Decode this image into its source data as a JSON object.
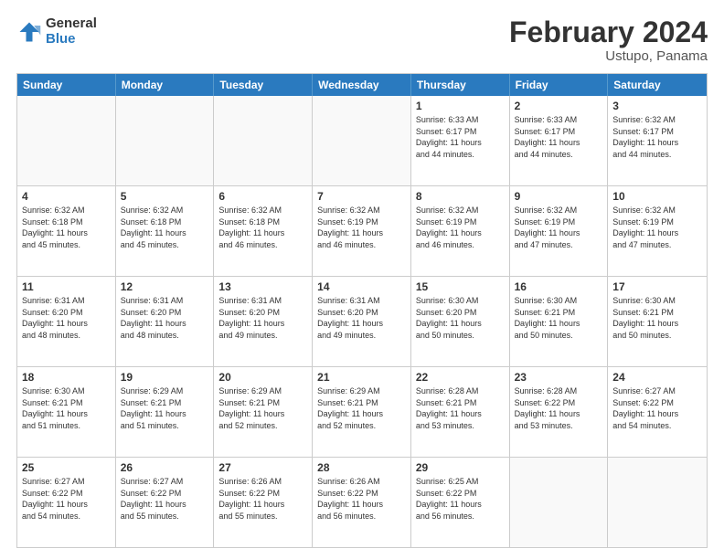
{
  "logo": {
    "general": "General",
    "blue": "Blue"
  },
  "title": "February 2024",
  "subtitle": "Ustupo, Panama",
  "header_days": [
    "Sunday",
    "Monday",
    "Tuesday",
    "Wednesday",
    "Thursday",
    "Friday",
    "Saturday"
  ],
  "rows": [
    [
      {
        "day": "",
        "info": "",
        "empty": true
      },
      {
        "day": "",
        "info": "",
        "empty": true
      },
      {
        "day": "",
        "info": "",
        "empty": true
      },
      {
        "day": "",
        "info": "",
        "empty": true
      },
      {
        "day": "1",
        "info": "Sunrise: 6:33 AM\nSunset: 6:17 PM\nDaylight: 11 hours\nand 44 minutes.",
        "empty": false
      },
      {
        "day": "2",
        "info": "Sunrise: 6:33 AM\nSunset: 6:17 PM\nDaylight: 11 hours\nand 44 minutes.",
        "empty": false
      },
      {
        "day": "3",
        "info": "Sunrise: 6:32 AM\nSunset: 6:17 PM\nDaylight: 11 hours\nand 44 minutes.",
        "empty": false
      }
    ],
    [
      {
        "day": "4",
        "info": "Sunrise: 6:32 AM\nSunset: 6:18 PM\nDaylight: 11 hours\nand 45 minutes.",
        "empty": false
      },
      {
        "day": "5",
        "info": "Sunrise: 6:32 AM\nSunset: 6:18 PM\nDaylight: 11 hours\nand 45 minutes.",
        "empty": false
      },
      {
        "day": "6",
        "info": "Sunrise: 6:32 AM\nSunset: 6:18 PM\nDaylight: 11 hours\nand 46 minutes.",
        "empty": false
      },
      {
        "day": "7",
        "info": "Sunrise: 6:32 AM\nSunset: 6:19 PM\nDaylight: 11 hours\nand 46 minutes.",
        "empty": false
      },
      {
        "day": "8",
        "info": "Sunrise: 6:32 AM\nSunset: 6:19 PM\nDaylight: 11 hours\nand 46 minutes.",
        "empty": false
      },
      {
        "day": "9",
        "info": "Sunrise: 6:32 AM\nSunset: 6:19 PM\nDaylight: 11 hours\nand 47 minutes.",
        "empty": false
      },
      {
        "day": "10",
        "info": "Sunrise: 6:32 AM\nSunset: 6:19 PM\nDaylight: 11 hours\nand 47 minutes.",
        "empty": false
      }
    ],
    [
      {
        "day": "11",
        "info": "Sunrise: 6:31 AM\nSunset: 6:20 PM\nDaylight: 11 hours\nand 48 minutes.",
        "empty": false
      },
      {
        "day": "12",
        "info": "Sunrise: 6:31 AM\nSunset: 6:20 PM\nDaylight: 11 hours\nand 48 minutes.",
        "empty": false
      },
      {
        "day": "13",
        "info": "Sunrise: 6:31 AM\nSunset: 6:20 PM\nDaylight: 11 hours\nand 49 minutes.",
        "empty": false
      },
      {
        "day": "14",
        "info": "Sunrise: 6:31 AM\nSunset: 6:20 PM\nDaylight: 11 hours\nand 49 minutes.",
        "empty": false
      },
      {
        "day": "15",
        "info": "Sunrise: 6:30 AM\nSunset: 6:20 PM\nDaylight: 11 hours\nand 50 minutes.",
        "empty": false
      },
      {
        "day": "16",
        "info": "Sunrise: 6:30 AM\nSunset: 6:21 PM\nDaylight: 11 hours\nand 50 minutes.",
        "empty": false
      },
      {
        "day": "17",
        "info": "Sunrise: 6:30 AM\nSunset: 6:21 PM\nDaylight: 11 hours\nand 50 minutes.",
        "empty": false
      }
    ],
    [
      {
        "day": "18",
        "info": "Sunrise: 6:30 AM\nSunset: 6:21 PM\nDaylight: 11 hours\nand 51 minutes.",
        "empty": false
      },
      {
        "day": "19",
        "info": "Sunrise: 6:29 AM\nSunset: 6:21 PM\nDaylight: 11 hours\nand 51 minutes.",
        "empty": false
      },
      {
        "day": "20",
        "info": "Sunrise: 6:29 AM\nSunset: 6:21 PM\nDaylight: 11 hours\nand 52 minutes.",
        "empty": false
      },
      {
        "day": "21",
        "info": "Sunrise: 6:29 AM\nSunset: 6:21 PM\nDaylight: 11 hours\nand 52 minutes.",
        "empty": false
      },
      {
        "day": "22",
        "info": "Sunrise: 6:28 AM\nSunset: 6:21 PM\nDaylight: 11 hours\nand 53 minutes.",
        "empty": false
      },
      {
        "day": "23",
        "info": "Sunrise: 6:28 AM\nSunset: 6:22 PM\nDaylight: 11 hours\nand 53 minutes.",
        "empty": false
      },
      {
        "day": "24",
        "info": "Sunrise: 6:27 AM\nSunset: 6:22 PM\nDaylight: 11 hours\nand 54 minutes.",
        "empty": false
      }
    ],
    [
      {
        "day": "25",
        "info": "Sunrise: 6:27 AM\nSunset: 6:22 PM\nDaylight: 11 hours\nand 54 minutes.",
        "empty": false
      },
      {
        "day": "26",
        "info": "Sunrise: 6:27 AM\nSunset: 6:22 PM\nDaylight: 11 hours\nand 55 minutes.",
        "empty": false
      },
      {
        "day": "27",
        "info": "Sunrise: 6:26 AM\nSunset: 6:22 PM\nDaylight: 11 hours\nand 55 minutes.",
        "empty": false
      },
      {
        "day": "28",
        "info": "Sunrise: 6:26 AM\nSunset: 6:22 PM\nDaylight: 11 hours\nand 56 minutes.",
        "empty": false
      },
      {
        "day": "29",
        "info": "Sunrise: 6:25 AM\nSunset: 6:22 PM\nDaylight: 11 hours\nand 56 minutes.",
        "empty": false
      },
      {
        "day": "",
        "info": "",
        "empty": true
      },
      {
        "day": "",
        "info": "",
        "empty": true
      }
    ]
  ]
}
